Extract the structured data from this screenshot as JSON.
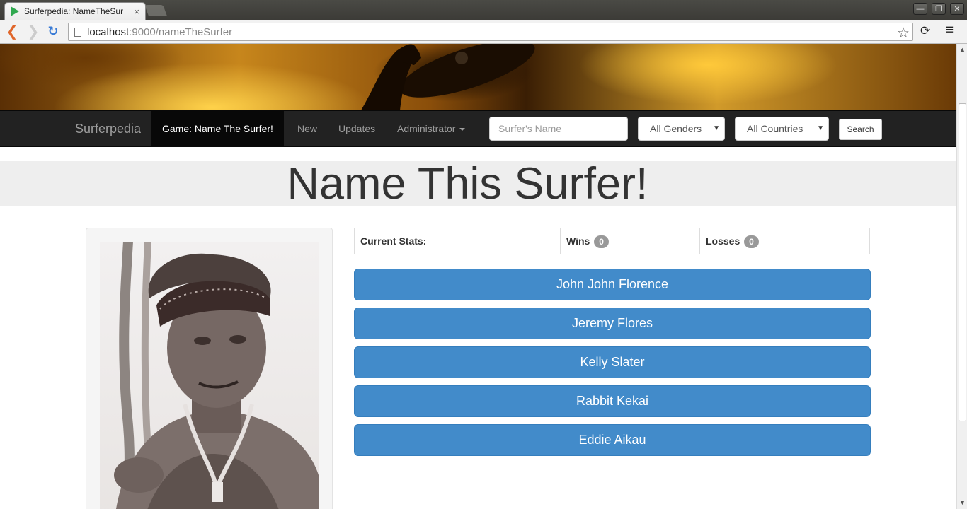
{
  "browser": {
    "tab_title": "Surferpedia: NameTheSur",
    "tab_close": "×",
    "url_host": "localhost",
    "url_path": ":9000/nameTheSurfer",
    "window_minimize": "—",
    "window_restore": "❐",
    "window_close": "✕"
  },
  "navbar": {
    "brand": "Surferpedia",
    "items": [
      {
        "label": "Game: Name The Surfer!",
        "active": true
      },
      {
        "label": "New"
      },
      {
        "label": "Updates"
      },
      {
        "label": "Administrator"
      }
    ],
    "search_placeholder": "Surfer's Name",
    "gender_select": "All Genders",
    "country_select": "All Countries",
    "search_button": "Search"
  },
  "page": {
    "heading": "Name This Surfer!",
    "stats": {
      "label": "Current Stats:",
      "wins_label": "Wins",
      "wins": "0",
      "losses_label": "Losses",
      "losses": "0"
    },
    "choices": [
      "John John Florence",
      "Jeremy Flores",
      "Kelly Slater",
      "Rabbit Kekai",
      "Eddie Aikau"
    ]
  },
  "colors": {
    "navbar_bg": "#222222",
    "primary_button": "#428bca",
    "jumbotron_bg": "#eeeeee"
  }
}
